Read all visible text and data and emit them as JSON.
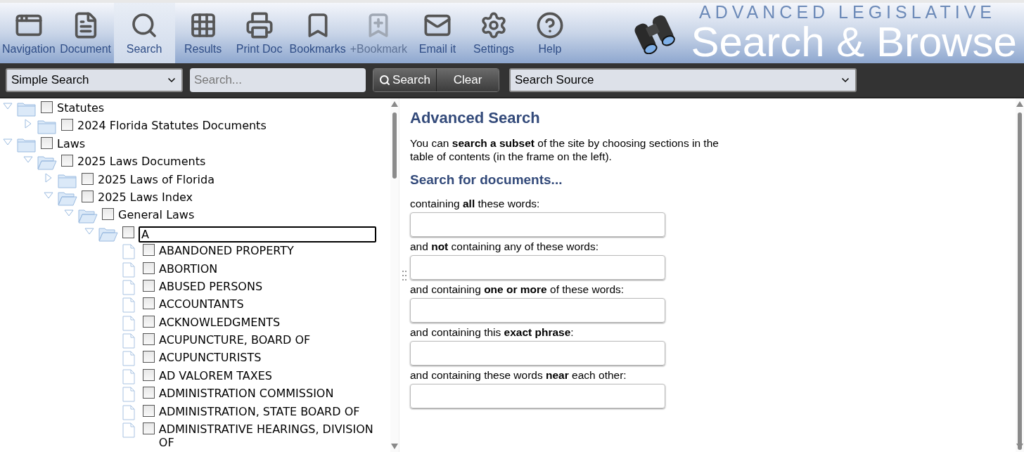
{
  "toolbar": [
    {
      "label": "Navigation",
      "selected": false,
      "disabled": false
    },
    {
      "label": "Document",
      "selected": false,
      "disabled": false
    },
    {
      "label": "Search",
      "selected": true,
      "disabled": false
    },
    {
      "label": "Results",
      "selected": false,
      "disabled": false
    },
    {
      "label": "Print Doc",
      "selected": false,
      "disabled": false
    },
    {
      "label": "Bookmarks",
      "selected": false,
      "disabled": false
    },
    {
      "label": "+Bookmark",
      "selected": false,
      "disabled": true
    },
    {
      "label": "Email it",
      "selected": false,
      "disabled": false
    },
    {
      "label": "Settings",
      "selected": false,
      "disabled": false
    },
    {
      "label": "Help",
      "selected": false,
      "disabled": false
    }
  ],
  "logo": {
    "subtitle": "ADVANCED LEGISLATIVE",
    "title": "Search & Browse"
  },
  "search_bar": {
    "mode": "Simple Search",
    "placeholder": "Search...",
    "search_button": "Search",
    "clear_button": "Clear",
    "source": "Search Source"
  },
  "tree": [
    {
      "kind": "folder",
      "label": "Statutes",
      "expanded": true,
      "checked": false,
      "children": [
        {
          "kind": "folder",
          "label": "2024 Florida Statutes Documents",
          "expanded": false,
          "checked": false
        }
      ]
    },
    {
      "kind": "folder",
      "label": "Laws",
      "expanded": true,
      "checked": false,
      "children": [
        {
          "kind": "folder",
          "label": "2025 Laws Documents",
          "expanded": true,
          "checked": false,
          "children": [
            {
              "kind": "folder",
              "label": "2025 Laws of Florida",
              "expanded": false,
              "checked": false
            },
            {
              "kind": "folder",
              "label": "2025 Laws Index",
              "expanded": true,
              "checked": false,
              "children": [
                {
                  "kind": "folder",
                  "label": "General Laws",
                  "expanded": true,
                  "checked": false,
                  "children": [
                    {
                      "kind": "folder",
                      "label": "A",
                      "expanded": true,
                      "checked": false,
                      "focused": true,
                      "children": [
                        {
                          "kind": "doc",
                          "label": "ABANDONED PROPERTY",
                          "checked": false
                        },
                        {
                          "kind": "doc",
                          "label": "ABORTION",
                          "checked": false
                        },
                        {
                          "kind": "doc",
                          "label": "ABUSED PERSONS",
                          "checked": false
                        },
                        {
                          "kind": "doc",
                          "label": "ACCOUNTANTS",
                          "checked": false
                        },
                        {
                          "kind": "doc",
                          "label": "ACKNOWLEDGMENTS",
                          "checked": false
                        },
                        {
                          "kind": "doc",
                          "label": "ACUPUNCTURE, BOARD OF",
                          "checked": false
                        },
                        {
                          "kind": "doc",
                          "label": "ACUPUNCTURISTS",
                          "checked": false
                        },
                        {
                          "kind": "doc",
                          "label": "AD VALOREM TAXES",
                          "checked": false
                        },
                        {
                          "kind": "doc",
                          "label": "ADMINISTRATION COMMISSION",
                          "checked": false
                        },
                        {
                          "kind": "doc",
                          "label": "ADMINISTRATION, STATE BOARD OF",
                          "checked": false
                        },
                        {
                          "kind": "doc",
                          "label": "ADMINISTRATIVE HEARINGS, DIVISION OF",
                          "checked": false
                        }
                      ]
                    }
                  ]
                }
              ]
            }
          ]
        }
      ]
    }
  ],
  "advanced": {
    "title": "Advanced Search",
    "intro": "You can **search a subset** of the site by choosing sections in the table of contents (in the frame on the left).",
    "subtitle": "Search for documents...",
    "fields": [
      {
        "label": "containing **all** these words:"
      },
      {
        "label": "and **not** containing any of these words:"
      },
      {
        "label": "and containing **one or more** of these words:"
      },
      {
        "label": "and containing this **exact phrase**:"
      },
      {
        "label": "and containing these words **near** each other:"
      }
    ]
  }
}
